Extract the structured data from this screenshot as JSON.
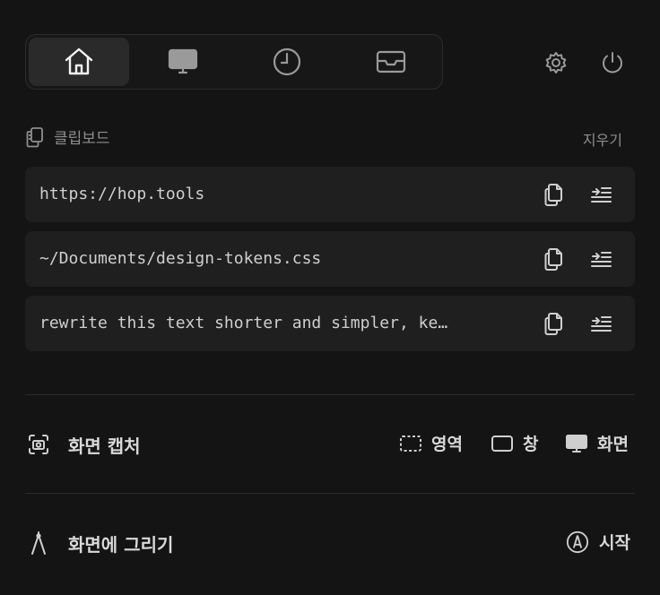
{
  "tabs": [
    {
      "icon": "home-icon",
      "active": true
    },
    {
      "icon": "monitor-icon",
      "active": false
    },
    {
      "icon": "clock-icon",
      "active": false
    },
    {
      "icon": "inbox-icon",
      "active": false
    }
  ],
  "top_actions": [
    "settings-icon",
    "power-icon"
  ],
  "clipboard": {
    "title": "클립보드",
    "clear_label": "지우기",
    "items": [
      {
        "text": "https://hop.tools"
      },
      {
        "text": "~/Documents/design-tokens.css"
      },
      {
        "text": "rewrite this text shorter and simpler, ke…"
      }
    ]
  },
  "capture": {
    "title": "화면 캡처",
    "options": {
      "area": "영역",
      "window": "창",
      "screen": "화면"
    }
  },
  "draw": {
    "title": "화면에 그리기",
    "start_label": "시작"
  }
}
